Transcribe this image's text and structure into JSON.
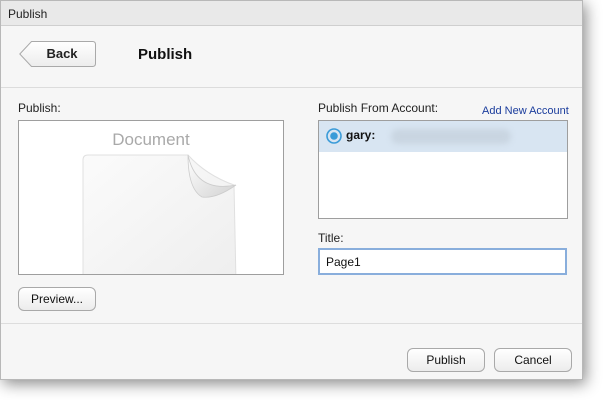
{
  "window": {
    "title": "Publish"
  },
  "header": {
    "back_label": "Back",
    "title": "Publish"
  },
  "left": {
    "publish_label": "Publish:",
    "document_label": "Document",
    "preview_button": "Preview..."
  },
  "right": {
    "account_label": "Publish From Account:",
    "add_account_link": "Add New Account",
    "accounts": [
      {
        "name": "gary:",
        "selected": true
      }
    ],
    "title_label": "Title:",
    "title_value": "Page1"
  },
  "footer": {
    "publish_button": "Publish",
    "cancel_button": "Cancel"
  },
  "colors": {
    "selected_row": "#d8e5f2",
    "link": "#1a3c9c",
    "focus_ring": "#89aedc",
    "account_icon": "#3a9bd8"
  },
  "icons": {
    "document": "document-icon",
    "account": "account-icon"
  }
}
